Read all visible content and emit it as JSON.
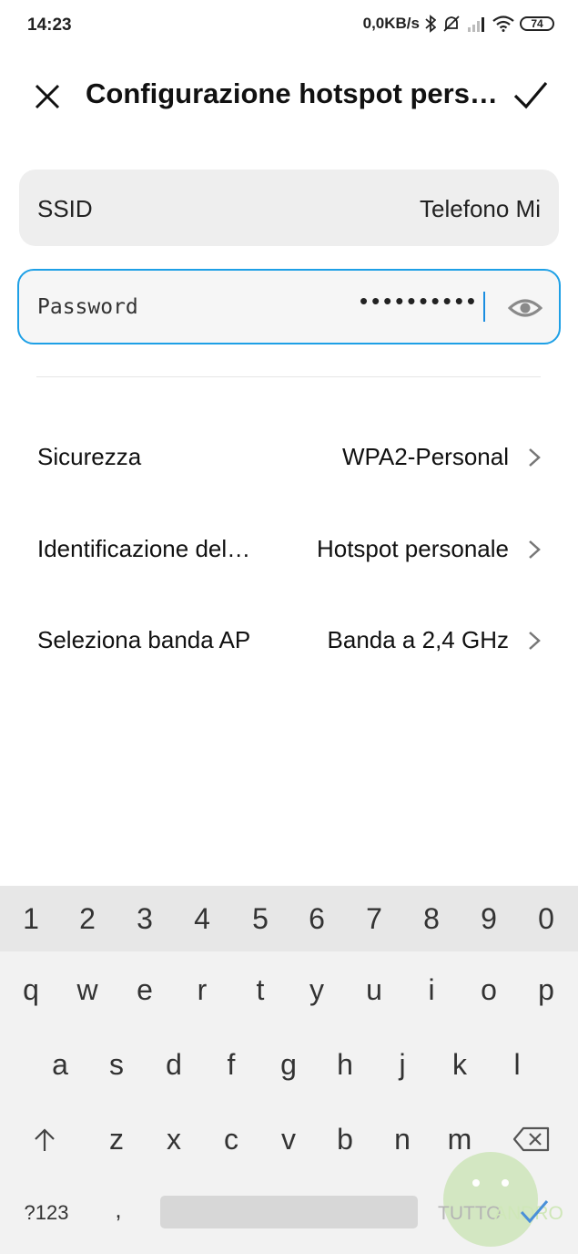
{
  "status_bar": {
    "time": "14:23",
    "speed": "0,0KB/s",
    "battery": "74",
    "icons": [
      "bluetooth-icon",
      "mute-icon",
      "signal-icon",
      "wifi-icon",
      "battery-icon"
    ]
  },
  "header": {
    "title": "Configurazione hotspot pers…",
    "close_icon": "close-icon",
    "confirm_icon": "check-icon"
  },
  "ssid": {
    "label": "SSID",
    "value": "Telefono Mi"
  },
  "password": {
    "label": "Password",
    "masked_value": "••••••••••",
    "toggle_icon": "eye-icon"
  },
  "settings": [
    {
      "label": "Sicurezza",
      "value": "WPA2-Personal"
    },
    {
      "label": "Identificazione del…",
      "value": "Hotspot personale"
    },
    {
      "label": "Seleziona banda AP",
      "value": "Banda a 2,4 GHz"
    }
  ],
  "keyboard": {
    "numbers": [
      "1",
      "2",
      "3",
      "4",
      "5",
      "6",
      "7",
      "8",
      "9",
      "0"
    ],
    "row1": [
      "q",
      "w",
      "e",
      "r",
      "t",
      "y",
      "u",
      "i",
      "o",
      "p"
    ],
    "row2": [
      "a",
      "s",
      "d",
      "f",
      "g",
      "h",
      "j",
      "k",
      "l"
    ],
    "row3": [
      "z",
      "x",
      "c",
      "v",
      "b",
      "n",
      "m"
    ],
    "symbols_key": "?123",
    "comma_key": ",",
    "accent_color": "#1ea0e6"
  },
  "watermark": {
    "text_a": "TUTTO",
    "text_b": "ANDROID"
  }
}
